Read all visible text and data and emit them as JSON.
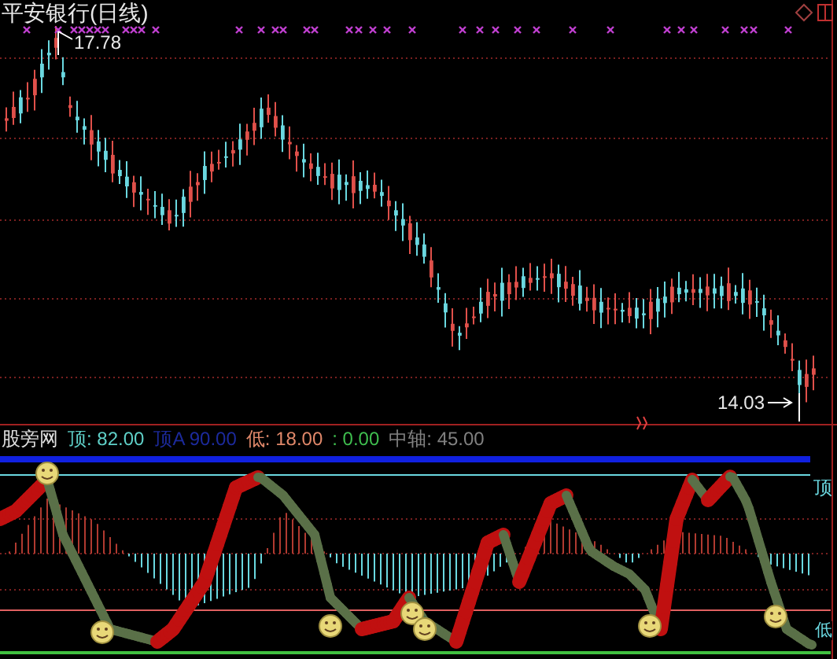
{
  "price_chart": {
    "title": "平安银行(日线)",
    "high_label": "17.78",
    "low_label": "14.03"
  },
  "indicator": {
    "name": "股旁网",
    "legend": [
      {
        "text": "顶: 82.00",
        "color": "#5fd0c8"
      },
      {
        "text": "顶A 90.00",
        "color": "#1c2a9c"
      },
      {
        "text": "低: 18.00",
        "color": "#e0886a"
      },
      {
        "text": ": 0.00",
        "color": "#3fbf4f"
      },
      {
        "text": "中轴: 45.00",
        "color": "#808080"
      }
    ],
    "top_label": "顶",
    "bottom_label": "低"
  }
}
